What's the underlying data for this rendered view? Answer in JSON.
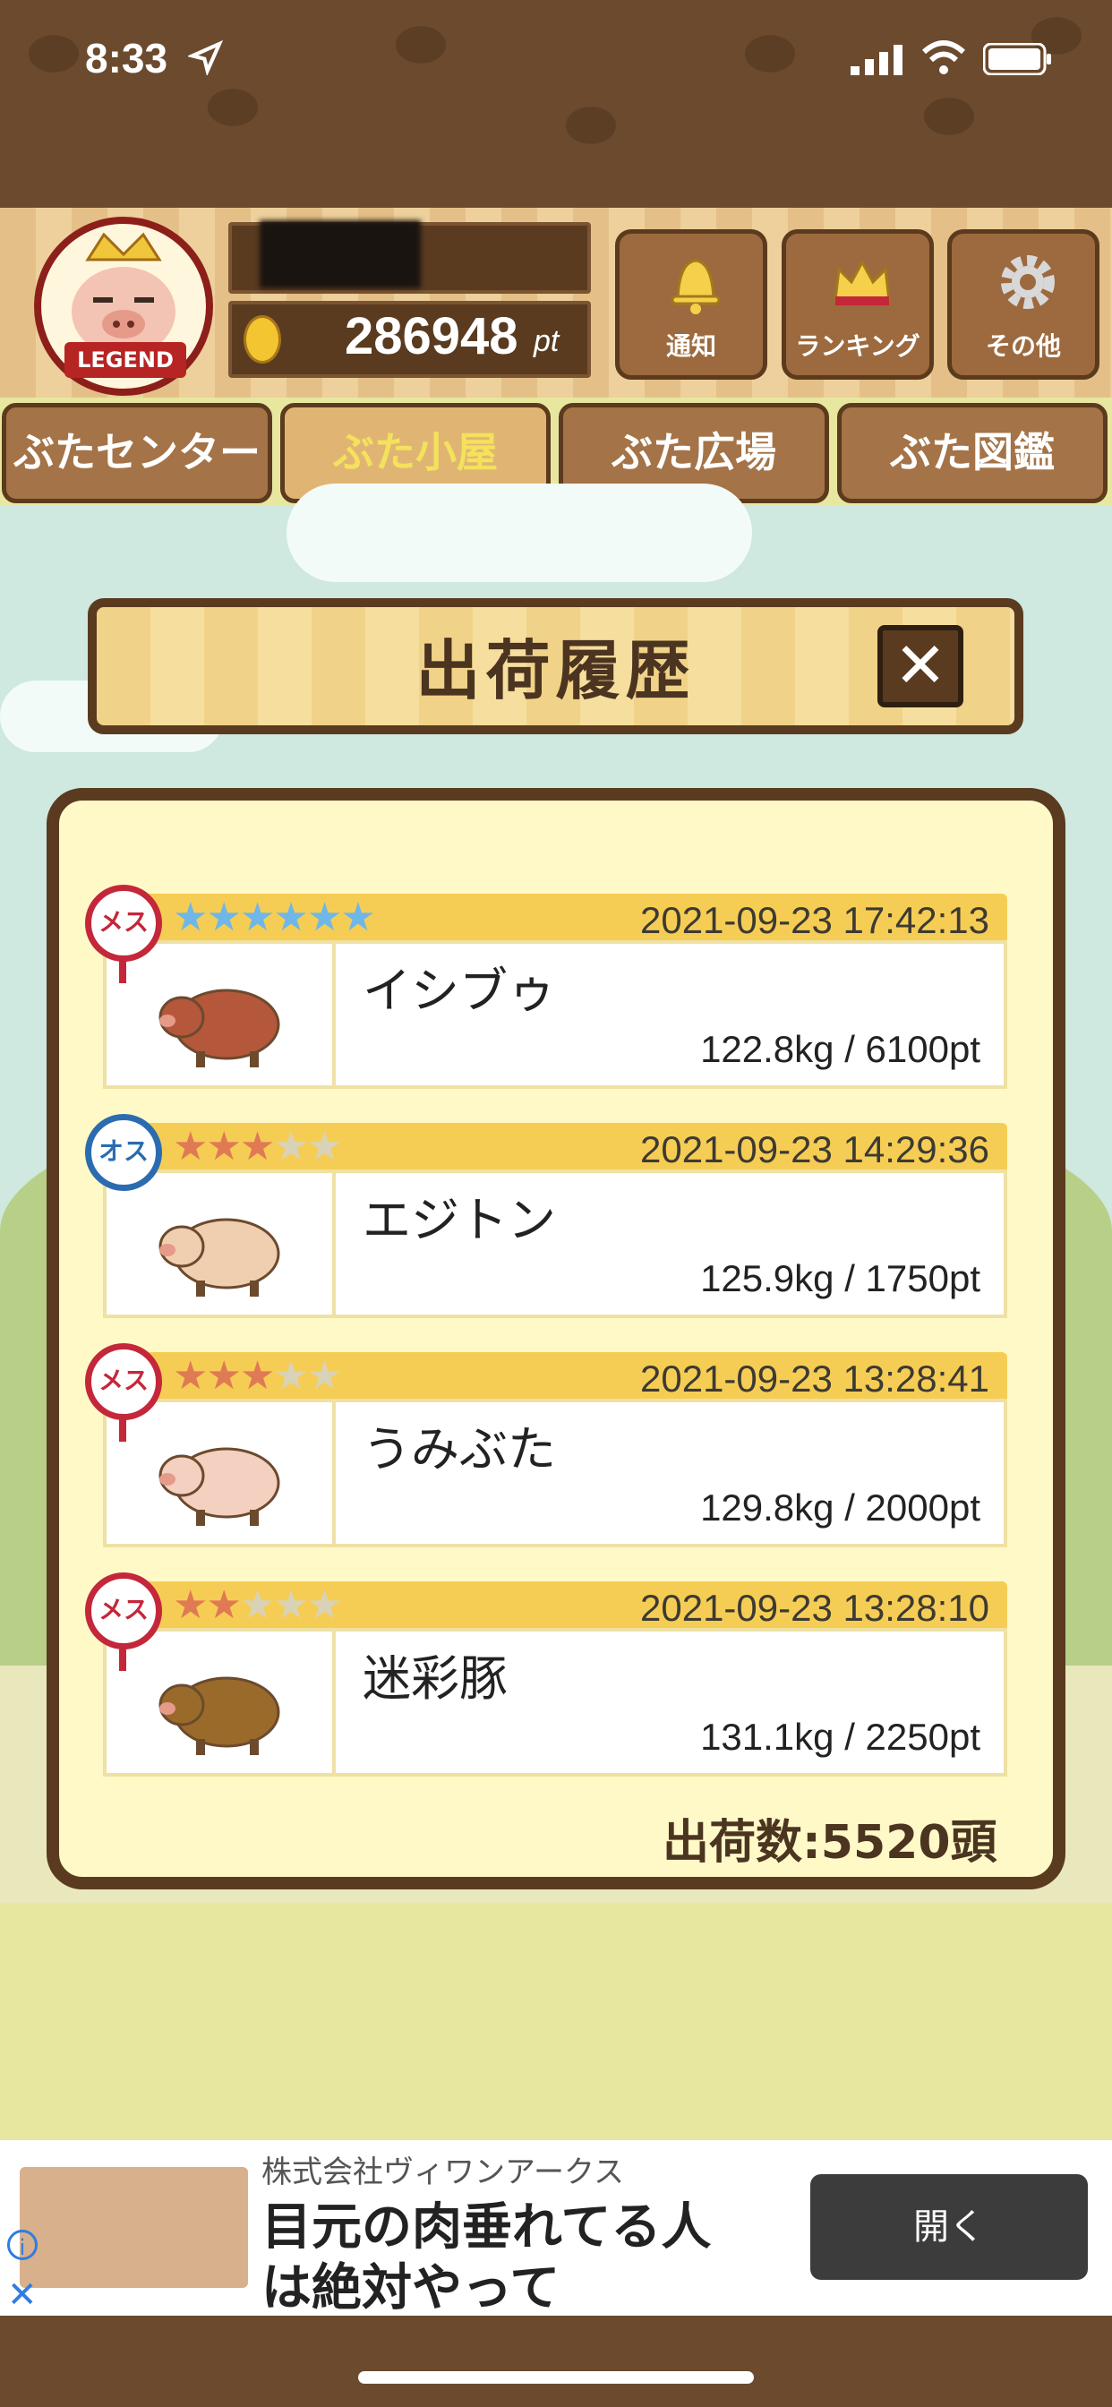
{
  "status": {
    "time": "8:33"
  },
  "header": {
    "avatar_label": "LEGEND",
    "points": "286948",
    "points_unit": "pt",
    "buttons": [
      {
        "label": "通知",
        "icon": "bell-icon"
      },
      {
        "label": "ランキング",
        "icon": "crown-icon"
      },
      {
        "label": "その他",
        "icon": "gear-icon"
      }
    ]
  },
  "nav": {
    "tabs": [
      {
        "label": "ぶたセンター",
        "active": false
      },
      {
        "label": "ぶた小屋",
        "active": true
      },
      {
        "label": "ぶた広場",
        "active": false
      },
      {
        "label": "ぶた図鑑",
        "active": false
      }
    ]
  },
  "panel": {
    "title": "出荷履歴",
    "close": "✕",
    "footer": "出荷数:5520頭"
  },
  "history": [
    {
      "gender": "メス",
      "stars": 6,
      "max_stars": 6,
      "star_color": "#6fb7e8",
      "date": "2021-09-23 17:42:13",
      "name": "イシブゥ",
      "weight": "122.8kg / 6100pt",
      "pig_color": "#b5573a"
    },
    {
      "gender": "オス",
      "stars": 3,
      "max_stars": 5,
      "star_color": "#e07a55",
      "date": "2021-09-23 14:29:36",
      "name": "エジトン",
      "weight": "125.9kg / 1750pt",
      "pig_color": "#f0cfb0"
    },
    {
      "gender": "メス",
      "stars": 3,
      "max_stars": 5,
      "star_color": "#e07a55",
      "date": "2021-09-23 13:28:41",
      "name": "うみぶた",
      "weight": "129.8kg / 2000pt",
      "pig_color": "#f4d0c0"
    },
    {
      "gender": "メス",
      "stars": 2,
      "max_stars": 5,
      "star_color": "#e07a55",
      "date": "2021-09-23 13:28:10",
      "name": "迷彩豚",
      "weight": "131.1kg / 2250pt",
      "pig_color": "#9a6a2a"
    }
  ],
  "ad": {
    "company": "株式会社ヴィワンアークス",
    "headline_line1": "目元の肉垂れてる人",
    "headline_line2": "は絶対やって",
    "button": "開く"
  }
}
